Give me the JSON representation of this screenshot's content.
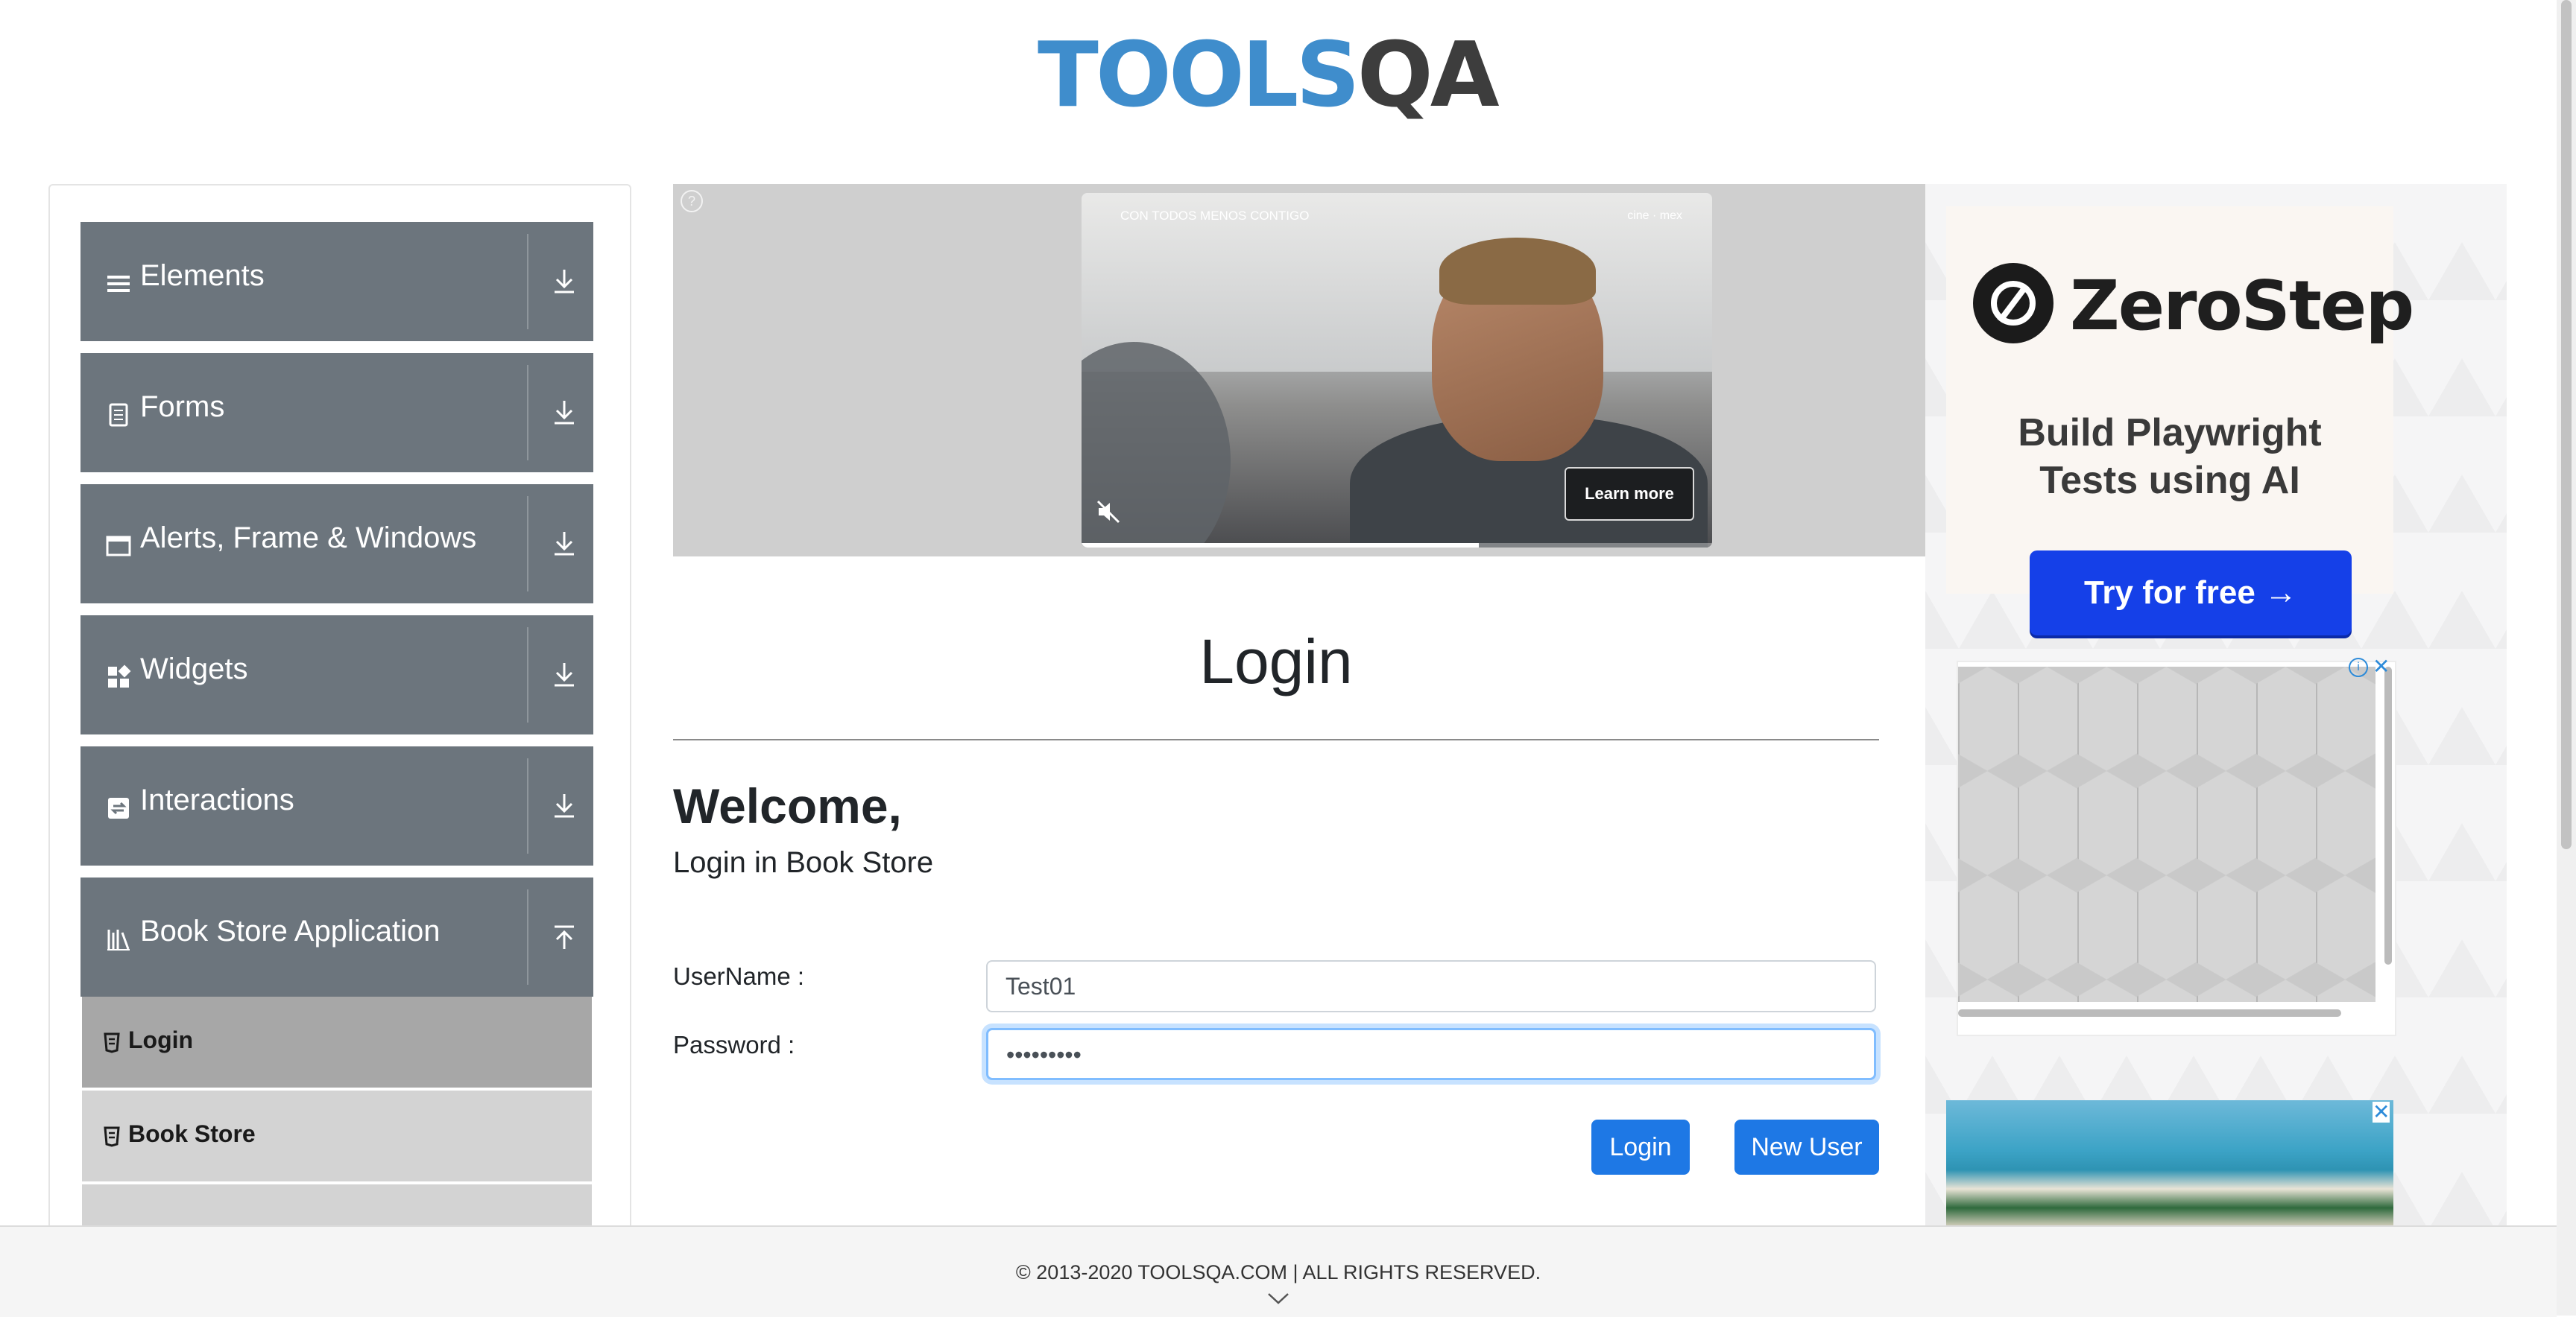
{
  "brand": {
    "logo_tools": "TOOLS",
    "logo_qa": "QA"
  },
  "sidebar": {
    "groups": [
      {
        "label": "Elements",
        "icon": "list-icon"
      },
      {
        "label": "Forms",
        "icon": "document-icon"
      },
      {
        "label": "Alerts, Frame & Windows",
        "icon": "window-icon"
      },
      {
        "label": "Widgets",
        "icon": "widgets-icon"
      },
      {
        "label": "Interactions",
        "icon": "interactions-icon"
      },
      {
        "label": "Book Store Application",
        "icon": "books-icon"
      }
    ],
    "bookstore_items": [
      {
        "label": "Login",
        "active": true
      },
      {
        "label": "Book Store",
        "active": false
      }
    ]
  },
  "video_ad": {
    "caption": "CON TODOS MENOS CONTIGO",
    "brand": "cine · mex",
    "learn_more": "Learn more",
    "progress": 0.63
  },
  "main": {
    "title": "Login",
    "welcome": "Welcome,",
    "subtitle": "Login in Book Store",
    "username_label": "UserName :",
    "username_value": "Test01",
    "password_label": "Password :",
    "password_value": "•••••••••",
    "login_button": "Login",
    "new_user_button": "New User"
  },
  "right_ads": {
    "zerostep_brand": "ZeroStep",
    "zerostep_tagline_1": "Build Playwright",
    "zerostep_tagline_2": "Tests using AI",
    "zerostep_cta": "Try for free →"
  },
  "footer": {
    "text": "© 2013-2020 TOOLSQA.COM | ALL RIGHTS RESERVED."
  },
  "colors": {
    "sidebar_group": "#6c757d",
    "primary_button": "#1e78e5",
    "zerostep_cta": "#1540e8",
    "logo_blue": "#3f8dcc"
  }
}
